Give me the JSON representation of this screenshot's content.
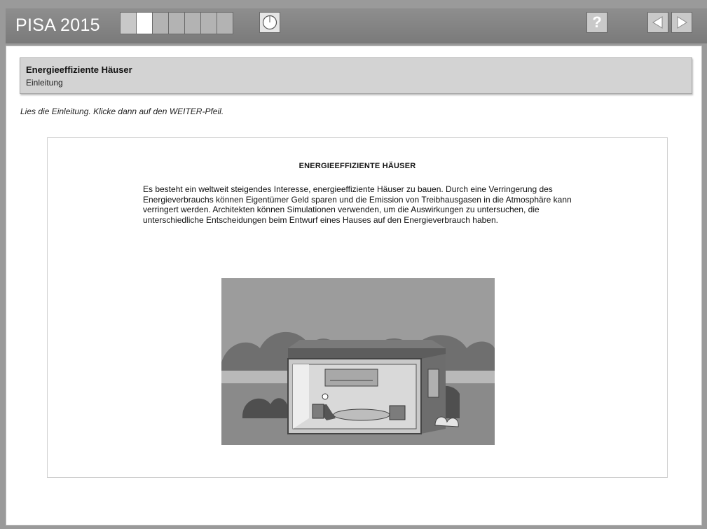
{
  "app": {
    "title": "PISA 2015"
  },
  "progress": {
    "total_segments": 7,
    "current_segment": 2
  },
  "icons": {
    "timer": "clock-icon",
    "help": "help-icon",
    "back": "back-arrow-icon",
    "next": "next-arrow-icon"
  },
  "toolbar": {
    "help_label": "?"
  },
  "unit": {
    "title": "Energieeffiziente Häuser",
    "subtitle": "Einleitung"
  },
  "instruction": "Lies die Einleitung. Klicke dann auf den WEITER-Pfeil.",
  "stimulus": {
    "heading": "ENERGIEEFFIZIENTE HÄUSER",
    "body": "Es besteht ein weltweit steigendes Interesse, energieeffiziente Häuser zu bauen. Durch eine Verringerung des Energieverbrauchs können Eigentümer Geld sparen und die Emission von Treibhausgasen in die Atmosphäre kann verringert werden. Architekten können Simulationen verwenden, um die Auswirkungen zu untersuchen, die unterschiedliche Entscheidungen beim Entwurf eines Hauses auf den Energieverbrauch haben."
  },
  "colors": {
    "topbar": "#7a7a7a",
    "header_bg": "#d3d3d3",
    "progress_active": "#ffffff"
  }
}
